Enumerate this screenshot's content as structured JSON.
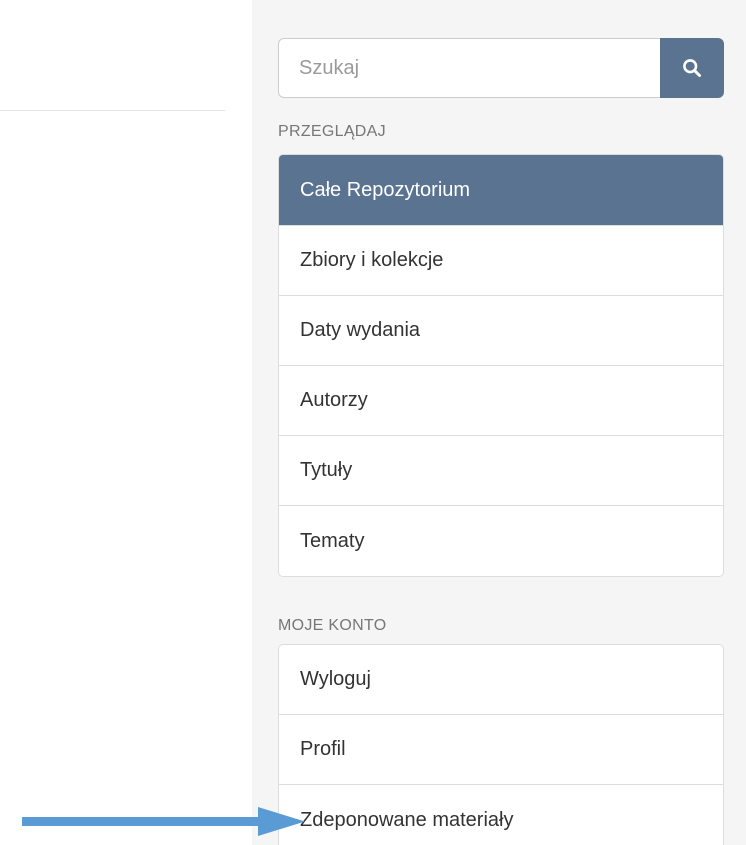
{
  "colors": {
    "accent": "#5a7390",
    "arrow": "#5b9bd5"
  },
  "search": {
    "placeholder": "Szukaj",
    "button_icon": "search-icon"
  },
  "browse": {
    "heading": "PRZEGLĄDAJ",
    "items": [
      {
        "label": "Całe Repozytorium",
        "active": true
      },
      {
        "label": "Zbiory i kolekcje"
      },
      {
        "label": "Daty wydania"
      },
      {
        "label": "Autorzy"
      },
      {
        "label": "Tytuły"
      },
      {
        "label": "Tematy"
      }
    ]
  },
  "account": {
    "heading": "MOJE KONTO",
    "items": [
      {
        "label": "Wyloguj"
      },
      {
        "label": "Profil"
      },
      {
        "label": "Zdeponowane materiały"
      }
    ]
  },
  "annotation": {
    "icon": "arrow-right-icon"
  }
}
